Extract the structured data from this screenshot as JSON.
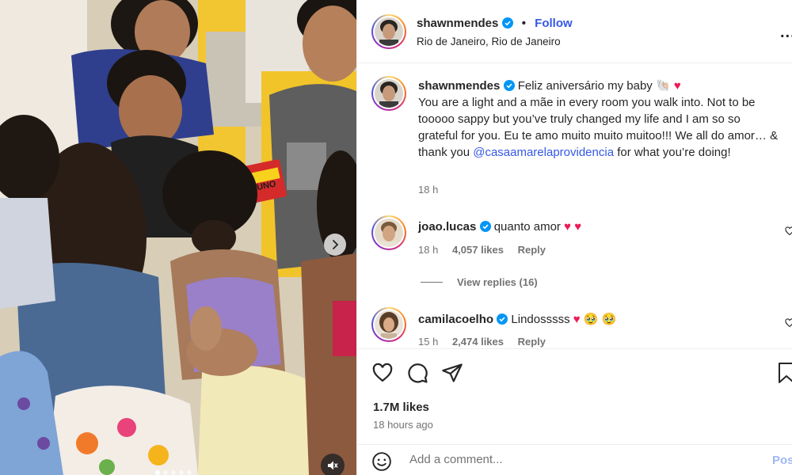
{
  "post": {
    "username": "shawnmendes",
    "follow_label": "Follow",
    "separator": "•",
    "location": "Rio de Janeiro, Rio de Janeiro",
    "more_label": "...",
    "caption_parts": {
      "lead": "Feliz aniversário my baby",
      "body1": "You are a light and a mãe in every room you walk into. Not to be tooooo sappy but you’ve truly changed my life and I am so so grateful for you. Eu te amo muito muito muitoo!!! We all do amor… & thank you",
      "mention": "@casaamarelaprovidencia",
      "body2": "for what you’re doing!"
    },
    "caption_time": "18 h",
    "likes": "1.7M likes",
    "posted_ago": "18 hours ago"
  },
  "comments": [
    {
      "username": "joao.lucas",
      "text": "quanto amor",
      "time": "18 h",
      "likes": "4,057 likes",
      "reply_label": "Reply"
    },
    {
      "username": "camilacoelho",
      "text": "Lindosssss",
      "time": "15 h",
      "likes": "2,474 likes",
      "reply_label": "Reply"
    }
  ],
  "view_replies_label": "View replies (16)",
  "add_comment": {
    "placeholder": "Add a comment...",
    "post_label": "Post"
  },
  "media": {
    "carousel_count": 5,
    "active_index": 0,
    "uno_text": "UNO"
  },
  "icons": {
    "heart": "heart-icon",
    "comment": "comment-icon",
    "share": "share-icon",
    "bookmark": "bookmark-icon",
    "emoji": "emoji-icon",
    "mute": "muted-speaker-icon",
    "next": "chevron-right-icon"
  },
  "colors": {
    "accent_blue": "#3558e6",
    "heart_red": "#ed1a55",
    "verified_blue": "#0095f6"
  }
}
